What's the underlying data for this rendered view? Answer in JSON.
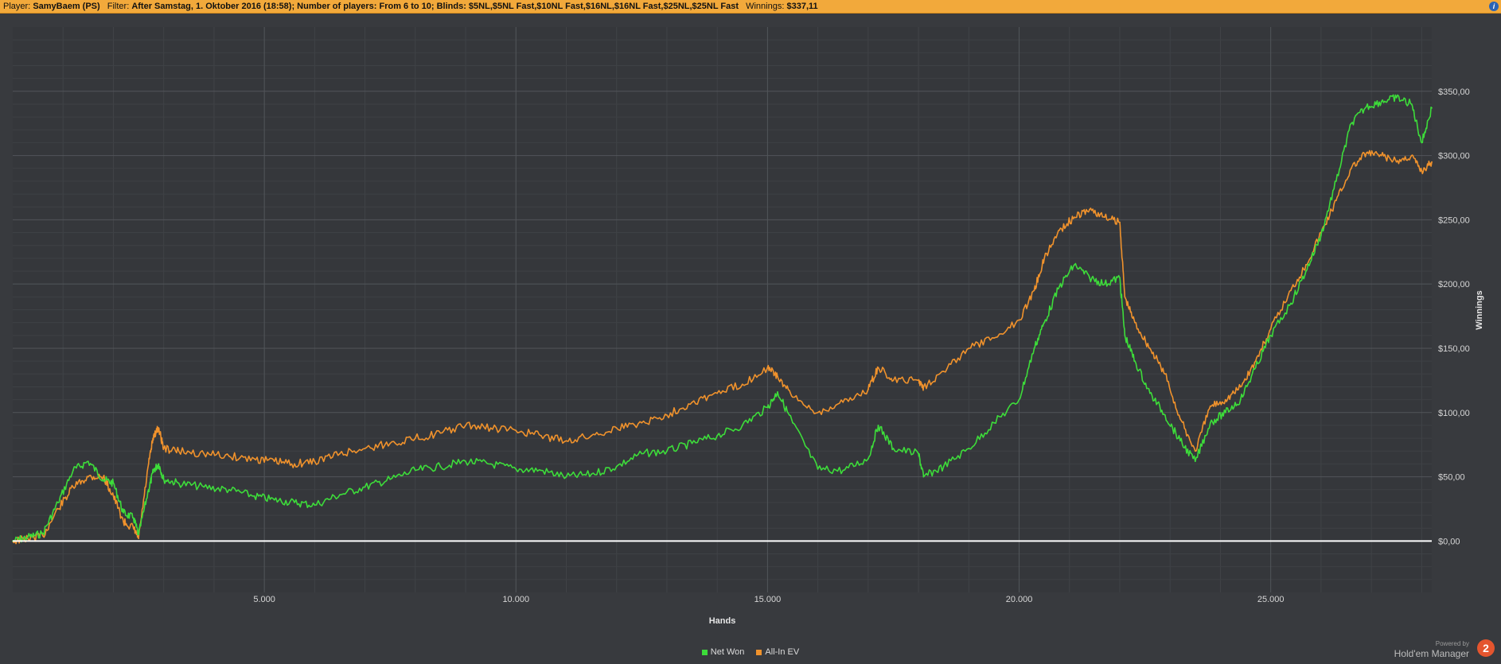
{
  "header": {
    "player_label": "Player:",
    "player_value": "SamyBaem (PS)",
    "filter_label": "Filter:",
    "filter_value": "After Samstag, 1. Oktober 2016 (18:58); Number of players: From 6 to 10; Blinds: $5NL,$5NL Fast,$10NL Fast,$16NL,$16NL Fast,$25NL,$25NL Fast",
    "winnings_label": "Winnings:",
    "winnings_value": "$337,11",
    "info_icon": "info-icon",
    "info_glyph": "i"
  },
  "footer": {
    "powered_by": "Powered by",
    "brand": "Hold'em Manager",
    "logo_icon": "hm2-logo-icon",
    "logo_glyph": "2"
  },
  "colors": {
    "background": "#383a3e",
    "net_won": "#3ddc3a",
    "all_in_ev": "#f0922c",
    "zero_line": "#ffffff",
    "grid": "#52555a"
  },
  "chart_data": {
    "type": "line",
    "title": "",
    "xlabel": "Hands",
    "ylabel": "Winnings",
    "xlim": [
      0,
      28200
    ],
    "ylim": [
      -40,
      400
    ],
    "x_ticks": [
      5000,
      10000,
      15000,
      20000,
      25000
    ],
    "x_tick_labels": [
      "5.000",
      "10.000",
      "15.000",
      "20.000",
      "25.000"
    ],
    "y_ticks": [
      0,
      50,
      100,
      150,
      200,
      250,
      300,
      350
    ],
    "y_tick_labels": [
      "$0,00",
      "$50,00",
      "$100,00",
      "$150,00",
      "$200,00",
      "$250,00",
      "$300,00",
      "$350,00"
    ],
    "y_axis_side": "right",
    "grid": true,
    "legend_position": "bottom-center",
    "series": [
      {
        "name": "Net Won",
        "color": "#3ddc3a",
        "x": [
          0,
          300,
          600,
          900,
          1200,
          1500,
          1800,
          2000,
          2200,
          2400,
          2500,
          2700,
          2800,
          2900,
          3000,
          3300,
          3800,
          4300,
          4800,
          5200,
          5600,
          6000,
          6500,
          7000,
          7500,
          8000,
          8500,
          9000,
          9500,
          10000,
          10500,
          11000,
          11500,
          12000,
          12500,
          13000,
          13500,
          14000,
          14500,
          15000,
          15200,
          15500,
          16000,
          16500,
          17000,
          17200,
          17500,
          18000,
          18100,
          18500,
          19000,
          19500,
          20000,
          20300,
          20500,
          20800,
          21100,
          21400,
          21700,
          22000,
          22100,
          22300,
          22600,
          22900,
          23200,
          23500,
          23800,
          24100,
          24400,
          24700,
          25000,
          25400,
          25700,
          26000,
          26300,
          26600,
          26900,
          27200,
          27500,
          27800,
          28000,
          28200
        ],
        "y": [
          0,
          3,
          6,
          30,
          55,
          62,
          48,
          45,
          22,
          18,
          5,
          40,
          55,
          60,
          48,
          45,
          42,
          40,
          35,
          32,
          30,
          28,
          36,
          42,
          48,
          55,
          58,
          62,
          60,
          56,
          55,
          50,
          52,
          58,
          68,
          70,
          76,
          82,
          90,
          104,
          116,
          92,
          56,
          55,
          64,
          90,
          72,
          68,
          50,
          58,
          72,
          92,
          110,
          150,
          170,
          198,
          215,
          205,
          200,
          205,
          160,
          140,
          115,
          98,
          78,
          62,
          92,
          100,
          110,
          135,
          160,
          185,
          210,
          238,
          280,
          325,
          338,
          342,
          345,
          340,
          310,
          337
        ]
      },
      {
        "name": "All-In EV",
        "color": "#f0922c",
        "x": [
          0,
          300,
          600,
          900,
          1200,
          1500,
          1800,
          2000,
          2200,
          2400,
          2500,
          2700,
          2800,
          2900,
          3000,
          3300,
          3800,
          4300,
          4800,
          5200,
          5600,
          6000,
          6500,
          7000,
          7500,
          8000,
          8500,
          9000,
          9500,
          10000,
          10500,
          11000,
          11500,
          12000,
          12500,
          13000,
          13500,
          14000,
          14500,
          15000,
          15200,
          15500,
          16000,
          16500,
          17000,
          17200,
          17500,
          18000,
          18100,
          18500,
          19000,
          19500,
          20000,
          20300,
          20500,
          20800,
          21100,
          21400,
          21700,
          22000,
          22100,
          22300,
          22600,
          22900,
          23200,
          23500,
          23800,
          24100,
          24400,
          24700,
          25000,
          25400,
          25700,
          26000,
          26300,
          26600,
          26900,
          27200,
          27500,
          27800,
          28000,
          28200
        ],
        "y": [
          0,
          2,
          4,
          25,
          42,
          50,
          50,
          35,
          15,
          10,
          2,
          60,
          82,
          88,
          72,
          70,
          68,
          66,
          64,
          62,
          60,
          62,
          68,
          72,
          76,
          80,
          84,
          90,
          88,
          86,
          82,
          78,
          82,
          88,
          92,
          98,
          108,
          115,
          122,
          135,
          128,
          112,
          100,
          108,
          118,
          135,
          125,
          125,
          120,
          132,
          150,
          158,
          172,
          195,
          220,
          242,
          252,
          258,
          252,
          248,
          190,
          170,
          150,
          130,
          95,
          70,
          105,
          110,
          120,
          140,
          165,
          195,
          215,
          240,
          265,
          290,
          302,
          300,
          295,
          300,
          288,
          295
        ]
      }
    ]
  }
}
